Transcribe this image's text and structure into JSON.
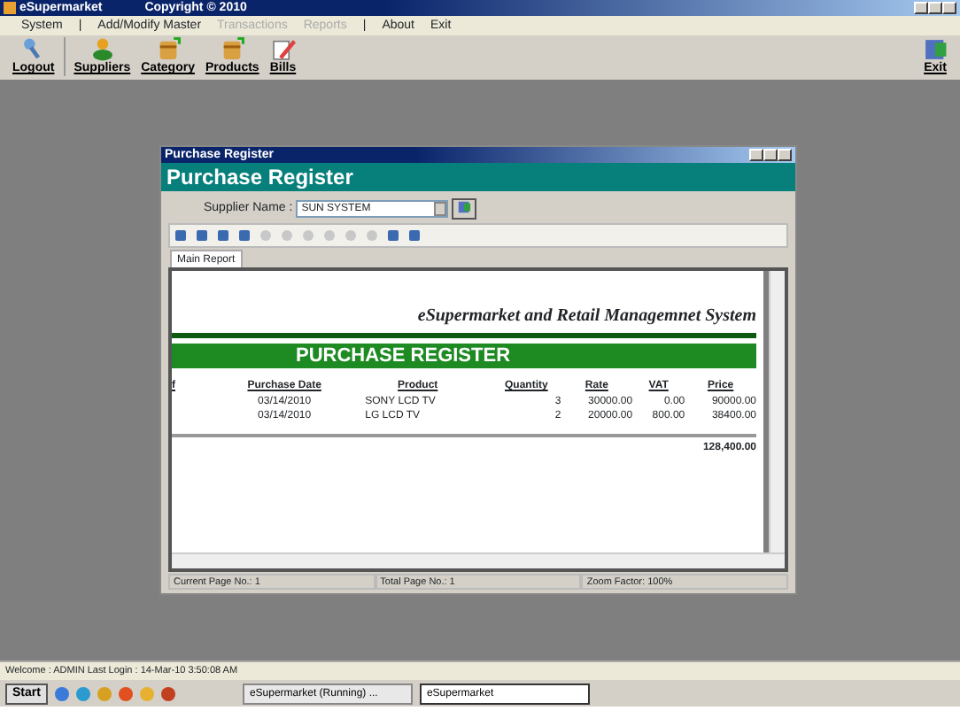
{
  "window": {
    "title": "eSupermarket",
    "copyright": "Copyright © 2010"
  },
  "menu": [
    {
      "kind": "item",
      "label": "System",
      "disabled": false
    },
    {
      "kind": "separator",
      "label": "|"
    },
    {
      "kind": "item",
      "label": "Add/Modify Master",
      "disabled": false
    },
    {
      "kind": "item",
      "label": "Transactions",
      "disabled": true
    },
    {
      "kind": "item",
      "label": "Reports",
      "disabled": true
    },
    {
      "kind": "separator",
      "label": "|"
    },
    {
      "kind": "item",
      "label": "About",
      "disabled": false
    },
    {
      "kind": "item",
      "label": "Exit",
      "disabled": false
    }
  ],
  "toolbar": [
    {
      "kind": "key",
      "label": "Logout"
    },
    {
      "kind": "people",
      "label": "Suppliers"
    },
    {
      "kind": "jar",
      "label": "Category"
    },
    {
      "kind": "jar",
      "label": "Products"
    },
    {
      "kind": "pencil",
      "label": "Bills"
    }
  ],
  "toolbar_right": {
    "label": "Exit"
  },
  "child_window": {
    "title": "Purchase Register",
    "header": "Purchase Register",
    "supplier": {
      "label": "Supplier Name :",
      "value": "SUN SYSTEM"
    },
    "report_toolbar": [
      {
        "disabled": false
      },
      {
        "disabled": false
      },
      {
        "disabled": false
      },
      {
        "disabled": false
      },
      {
        "disabled": true
      },
      {
        "disabled": true
      },
      {
        "disabled": true
      },
      {
        "disabled": true
      },
      {
        "disabled": true
      },
      {
        "disabled": true
      },
      {
        "disabled": false
      },
      {
        "disabled": false
      }
    ],
    "tabs": [
      {
        "label": "Main Report",
        "selected": true
      }
    ],
    "report": {
      "company": "eSupermarket and Retail Managemnet System",
      "title": "PURCHASE REGISTER",
      "columns": [
        "f",
        "Purchase Date",
        "Product",
        "Quantity",
        "Rate",
        "VAT",
        "Price"
      ],
      "rows": [
        {
          "date": "03/14/2010",
          "product": "SONY LCD TV",
          "quantity": "3",
          "rate": "30000.00",
          "vat": "0.00",
          "price": "90000.00"
        },
        {
          "date": "03/14/2010",
          "product": "LG LCD TV",
          "quantity": "2",
          "rate": "20000.00",
          "vat": "800.00",
          "price": "38400.00"
        }
      ],
      "total": "128,400.00"
    },
    "status": [
      "Current Page No.: 1",
      "Total Page No.: 1",
      "Zoom Factor: 100%"
    ]
  },
  "status_bar": "Welcome : ADMIN  Last Login : 14-Mar-10 3:50:08 AM",
  "taskbar": {
    "start": "Start",
    "tasks": [
      {
        "label": "eSupermarket (Running) ...",
        "selected": false
      },
      {
        "label": "eSupermarket",
        "selected": true
      }
    ]
  }
}
